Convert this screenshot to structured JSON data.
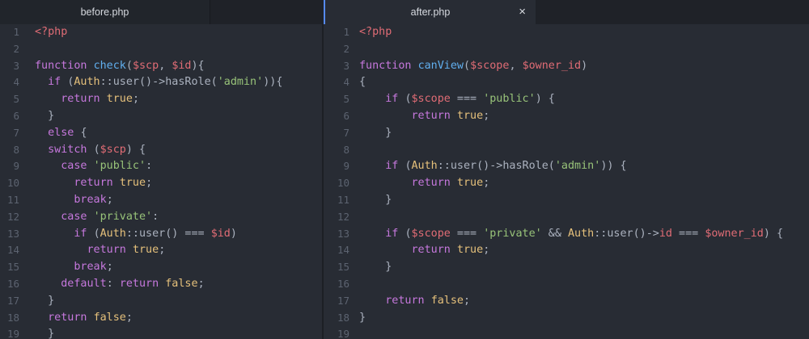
{
  "tabs": {
    "left": {
      "label": "before.php"
    },
    "right": {
      "label": "after.php",
      "close": "×"
    }
  },
  "colors": {
    "background": "#282c34",
    "keyword": "#c678dd",
    "function": "#61afef",
    "variable": "#e06c75",
    "string": "#98c379",
    "class": "#e5c07b",
    "plain": "#abb2bf",
    "line_number": "#5c6370",
    "active_tab_accent": "#568af2"
  },
  "before": {
    "lines": [
      [
        [
          "tag",
          "<?php"
        ]
      ],
      [],
      [
        [
          "kw",
          "function "
        ],
        [
          "fn",
          "check"
        ],
        [
          "pl",
          "("
        ],
        [
          "var",
          "$scp"
        ],
        [
          "pl",
          ", "
        ],
        [
          "var",
          "$id"
        ],
        [
          "pl",
          "){"
        ]
      ],
      [
        [
          "pl",
          "  "
        ],
        [
          "kw",
          "if "
        ],
        [
          "pl",
          "("
        ],
        [
          "cls",
          "Auth"
        ],
        [
          "pl",
          "::user()->hasRole("
        ],
        [
          "str",
          "'admin'"
        ],
        [
          "pl",
          "))"
        ],
        [
          "pl",
          "{"
        ]
      ],
      [
        [
          "pl",
          "    "
        ],
        [
          "kw",
          "return "
        ],
        [
          "cls",
          "true"
        ],
        [
          "pl",
          ";"
        ]
      ],
      [
        [
          "pl",
          "  }"
        ]
      ],
      [
        [
          "pl",
          "  "
        ],
        [
          "kw",
          "else "
        ],
        [
          "pl",
          "{"
        ]
      ],
      [
        [
          "pl",
          "  "
        ],
        [
          "kw",
          "switch "
        ],
        [
          "pl",
          "("
        ],
        [
          "var",
          "$scp"
        ],
        [
          "pl",
          ") {"
        ]
      ],
      [
        [
          "pl",
          "    "
        ],
        [
          "kw",
          "case "
        ],
        [
          "str",
          "'public'"
        ],
        [
          "pl",
          ":"
        ]
      ],
      [
        [
          "pl",
          "      "
        ],
        [
          "kw",
          "return "
        ],
        [
          "cls",
          "true"
        ],
        [
          "pl",
          ";"
        ]
      ],
      [
        [
          "pl",
          "      "
        ],
        [
          "kw",
          "break"
        ],
        [
          "pl",
          ";"
        ]
      ],
      [
        [
          "pl",
          "    "
        ],
        [
          "kw",
          "case "
        ],
        [
          "str",
          "'private'"
        ],
        [
          "pl",
          ":"
        ]
      ],
      [
        [
          "pl",
          "      "
        ],
        [
          "kw",
          "if "
        ],
        [
          "pl",
          "("
        ],
        [
          "cls",
          "Auth"
        ],
        [
          "pl",
          "::user() === "
        ],
        [
          "var",
          "$id"
        ],
        [
          "pl",
          ")"
        ]
      ],
      [
        [
          "pl",
          "        "
        ],
        [
          "kw",
          "return "
        ],
        [
          "cls",
          "true"
        ],
        [
          "pl",
          ";"
        ]
      ],
      [
        [
          "pl",
          "      "
        ],
        [
          "kw",
          "break"
        ],
        [
          "pl",
          ";"
        ]
      ],
      [
        [
          "pl",
          "    "
        ],
        [
          "kw",
          "default"
        ],
        [
          "pl",
          ": "
        ],
        [
          "kw",
          "return "
        ],
        [
          "cls",
          "false"
        ],
        [
          "pl",
          ";"
        ]
      ],
      [
        [
          "pl",
          "  }"
        ]
      ],
      [
        [
          "pl",
          "  "
        ],
        [
          "kw",
          "return "
        ],
        [
          "cls",
          "false"
        ],
        [
          "pl",
          ";"
        ]
      ],
      [
        [
          "pl",
          "  }"
        ]
      ]
    ]
  },
  "after": {
    "lines": [
      [
        [
          "tag",
          "<?php"
        ]
      ],
      [],
      [
        [
          "kw",
          "function "
        ],
        [
          "fn",
          "canView"
        ],
        [
          "pl",
          "("
        ],
        [
          "var",
          "$scope"
        ],
        [
          "pl",
          ", "
        ],
        [
          "var",
          "$owner_id"
        ],
        [
          "pl",
          ")"
        ]
      ],
      [
        [
          "pl",
          "{"
        ]
      ],
      [
        [
          "pl",
          "    "
        ],
        [
          "kw",
          "if "
        ],
        [
          "pl",
          "("
        ],
        [
          "var",
          "$scope"
        ],
        [
          "pl",
          " === "
        ],
        [
          "str",
          "'public'"
        ],
        [
          "pl",
          ") {"
        ]
      ],
      [
        [
          "pl",
          "        "
        ],
        [
          "kw",
          "return "
        ],
        [
          "cls",
          "true"
        ],
        [
          "pl",
          ";"
        ]
      ],
      [
        [
          "pl",
          "    }"
        ]
      ],
      [],
      [
        [
          "pl",
          "    "
        ],
        [
          "kw",
          "if "
        ],
        [
          "pl",
          "("
        ],
        [
          "cls",
          "Auth"
        ],
        [
          "pl",
          "::user()->hasRole("
        ],
        [
          "str",
          "'admin'"
        ],
        [
          "pl",
          ")) {"
        ]
      ],
      [
        [
          "pl",
          "        "
        ],
        [
          "kw",
          "return "
        ],
        [
          "cls",
          "true"
        ],
        [
          "pl",
          ";"
        ]
      ],
      [
        [
          "pl",
          "    }"
        ]
      ],
      [],
      [
        [
          "pl",
          "    "
        ],
        [
          "kw",
          "if "
        ],
        [
          "pl",
          "("
        ],
        [
          "var",
          "$scope"
        ],
        [
          "pl",
          " === "
        ],
        [
          "str",
          "'private'"
        ],
        [
          "pl",
          " && "
        ],
        [
          "cls",
          "Auth"
        ],
        [
          "pl",
          "::user()->"
        ],
        [
          "var",
          "id"
        ],
        [
          "pl",
          " === "
        ],
        [
          "var",
          "$owner_id"
        ],
        [
          "pl",
          ") {"
        ]
      ],
      [
        [
          "pl",
          "        "
        ],
        [
          "kw",
          "return "
        ],
        [
          "cls",
          "true"
        ],
        [
          "pl",
          ";"
        ]
      ],
      [
        [
          "pl",
          "    }"
        ]
      ],
      [],
      [
        [
          "pl",
          "    "
        ],
        [
          "kw",
          "return "
        ],
        [
          "cls",
          "false"
        ],
        [
          "pl",
          ";"
        ]
      ],
      [
        [
          "pl",
          "}"
        ]
      ],
      []
    ]
  }
}
